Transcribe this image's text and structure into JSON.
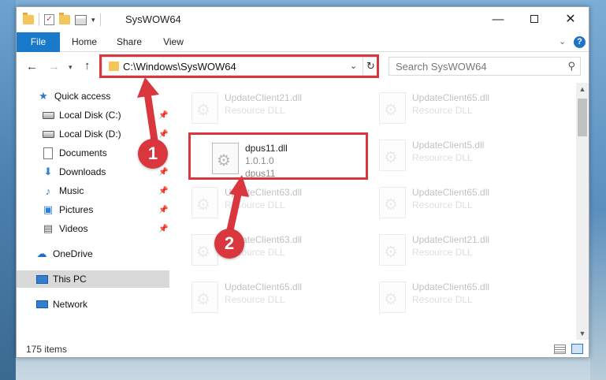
{
  "window": {
    "title": "SysWOW64"
  },
  "ribbon": {
    "tabs": [
      "File",
      "Home",
      "Share",
      "View"
    ],
    "help": "?"
  },
  "nav": {
    "address": "C:\\Windows\\SysWOW64",
    "search_placeholder": "Search SysWOW64"
  },
  "sidebar": {
    "items": [
      {
        "label": "Quick access",
        "icon": "star-icon",
        "pinned": false
      },
      {
        "label": "Local Disk (C:)",
        "icon": "drive-icon",
        "pinned": true
      },
      {
        "label": "Local Disk (D:)",
        "icon": "drive-icon",
        "pinned": true
      },
      {
        "label": "Documents",
        "icon": "documents-icon",
        "pinned": true
      },
      {
        "label": "Downloads",
        "icon": "downloads-icon",
        "pinned": true
      },
      {
        "label": "Music",
        "icon": "music-icon",
        "pinned": true
      },
      {
        "label": "Pictures",
        "icon": "pictures-icon",
        "pinned": true
      },
      {
        "label": "Videos",
        "icon": "videos-icon",
        "pinned": true
      },
      {
        "label": "OneDrive",
        "icon": "cloud-icon",
        "pinned": false
      },
      {
        "label": "This PC",
        "icon": "computer-icon",
        "pinned": false,
        "selected": true
      },
      {
        "label": "Network",
        "icon": "network-icon",
        "pinned": false
      }
    ]
  },
  "files": [
    {
      "name": "UpdateClient21.dll",
      "line2": "Resource DLL",
      "line3": "",
      "faded": true
    },
    {
      "name": "UpdateClient65.dll",
      "line2": "Resource DLL",
      "line3": "",
      "faded": true
    },
    {
      "name": "dpus11.dll",
      "line2": "1.0.1.0",
      "line3": "dpus11",
      "faded": false
    },
    {
      "name": "UpdateClient5.dll",
      "line2": "Resource DLL",
      "line3": "",
      "faded": true
    },
    {
      "name": "UpdateClient63.dll",
      "line2": "Resource DLL",
      "line3": "",
      "faded": true
    },
    {
      "name": "UpdateClient65.dll",
      "line2": "Resource DLL",
      "line3": "",
      "faded": true
    },
    {
      "name": "UpdateClient63.dll",
      "line2": "Resource DLL",
      "line3": "",
      "faded": true
    },
    {
      "name": "UpdateClient21.dll",
      "line2": "Resource DLL",
      "line3": "",
      "faded": true
    },
    {
      "name": "UpdateClient65.dll",
      "line2": "Resource DLL",
      "line3": "",
      "faded": true
    },
    {
      "name": "UpdateClient65.dll",
      "line2": "Resource DLL",
      "line3": "",
      "faded": true
    }
  ],
  "status": {
    "count": "175 items"
  },
  "annotations": {
    "step1": "1",
    "step2": "2",
    "color": "#d9363e"
  }
}
